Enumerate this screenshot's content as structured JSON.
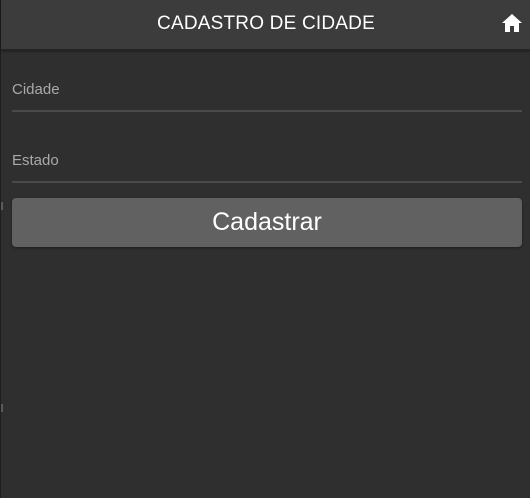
{
  "header": {
    "title": "CADASTRO DE CIDADE",
    "home_icon": "home-icon"
  },
  "form": {
    "cidade_placeholder": "Cidade",
    "cidade_value": "",
    "estado_placeholder": "Estado",
    "estado_value": "",
    "submit_label": "Cadastrar"
  },
  "colors": {
    "background": "#2f2f2f",
    "header": "#3c3c3c",
    "button": "#616161",
    "underline": "#4a4a4a"
  }
}
